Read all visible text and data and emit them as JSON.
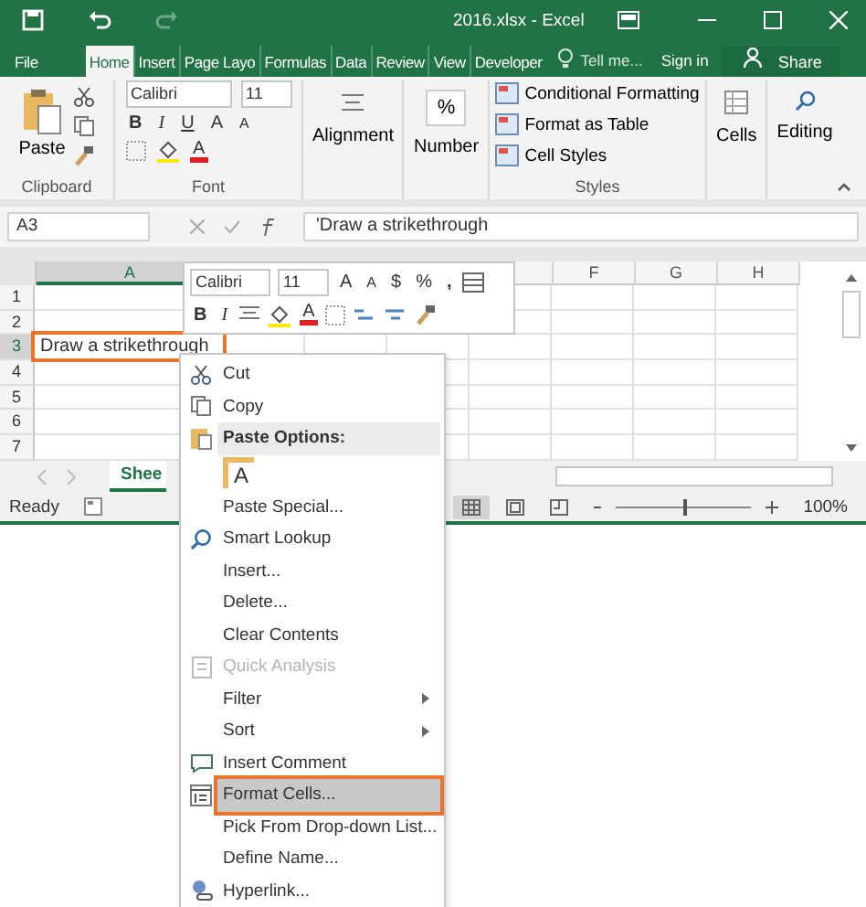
{
  "window": {
    "title": "2016.xlsx - Excel"
  },
  "ribbon_tabs": [
    {
      "label": "File",
      "selected": false
    },
    {
      "label": "Home",
      "selected": true
    },
    {
      "label": "Insert",
      "selected": false
    },
    {
      "label": "Page Layo",
      "selected": false
    },
    {
      "label": "Formulas",
      "selected": false
    },
    {
      "label": "Data",
      "selected": false
    },
    {
      "label": "Review",
      "selected": false
    },
    {
      "label": "View",
      "selected": false
    },
    {
      "label": "Developer",
      "selected": false
    }
  ],
  "tell_me": "Tell me...",
  "sign_in": "Sign in",
  "share": "Share",
  "ribbon": {
    "paste": "Paste",
    "font_name": "Calibri",
    "font_size": "11",
    "bold": "B",
    "italic": "I",
    "underline": "U",
    "grow": "A",
    "shrink": "A",
    "font_color": "A",
    "alignment": "Alignment",
    "number_icon": "%",
    "number": "Number",
    "styles": [
      "Conditional Formatting",
      "Format as Table",
      "Cell Styles"
    ],
    "cells": "Cells",
    "editing": "Editing",
    "groups": [
      "Clipboard",
      "Font",
      "Styles"
    ]
  },
  "formula_bar": {
    "name_box": "A3",
    "value": "'Draw a strikethrough"
  },
  "grid": {
    "columns": [
      {
        "label": "A",
        "selected": true
      },
      {
        "label": "F",
        "selected": false
      },
      {
        "label": "G",
        "selected": false
      },
      {
        "label": "H",
        "selected": false
      }
    ],
    "rows": [
      {
        "label": "1",
        "selected": false
      },
      {
        "label": "2",
        "selected": false
      },
      {
        "label": "3",
        "selected": true,
        "cell": "Draw a strikethrough"
      },
      {
        "label": "4",
        "selected": false
      },
      {
        "label": "5",
        "selected": false
      },
      {
        "label": "6",
        "selected": false
      },
      {
        "label": "7",
        "selected": false
      }
    ]
  },
  "sheet_tab": "Shee",
  "status_bar": {
    "status": "Ready",
    "zoom": "100%",
    "zoom_level": {
      "level": 0.5
    }
  },
  "mini_toolbar": {
    "font": "Calibri",
    "size": "11",
    "grow": "A",
    "shrink": "A",
    "currency": "$",
    "percent": "%",
    "comma": ",",
    "bold": "B",
    "italic": "I",
    "font_color": "A"
  },
  "context_menu": [
    {
      "kind": "item",
      "label": "Cut",
      "disabled": false,
      "selected": false
    },
    {
      "kind": "item",
      "label": "Copy",
      "disabled": false,
      "selected": false
    },
    {
      "kind": "header",
      "label": "Paste Options:"
    },
    {
      "kind": "paste-option",
      "label": "A"
    },
    {
      "kind": "item",
      "label": "Paste Special...",
      "disabled": false,
      "selected": false
    },
    {
      "kind": "item",
      "label": "Smart Lookup",
      "disabled": false,
      "selected": false
    },
    {
      "kind": "item",
      "label": "Insert...",
      "disabled": false,
      "selected": false
    },
    {
      "kind": "item",
      "label": "Delete...",
      "disabled": false,
      "selected": false
    },
    {
      "kind": "item",
      "label": "Clear Contents",
      "disabled": false,
      "selected": false
    },
    {
      "kind": "item",
      "label": "Quick Analysis",
      "disabled": true,
      "selected": false
    },
    {
      "kind": "submenu",
      "label": "Filter",
      "disabled": false,
      "selected": false
    },
    {
      "kind": "submenu",
      "label": "Sort",
      "disabled": false,
      "selected": false
    },
    {
      "kind": "item",
      "label": "Insert Comment",
      "disabled": false,
      "selected": false
    },
    {
      "kind": "item",
      "label": "Format Cells...",
      "disabled": false,
      "selected": true
    },
    {
      "kind": "item",
      "label": "Pick From Drop-down List...",
      "disabled": false,
      "selected": false
    },
    {
      "kind": "item",
      "label": "Define Name...",
      "disabled": false,
      "selected": false
    },
    {
      "kind": "item",
      "label": "Hyperlink...",
      "disabled": false,
      "selected": false
    }
  ]
}
